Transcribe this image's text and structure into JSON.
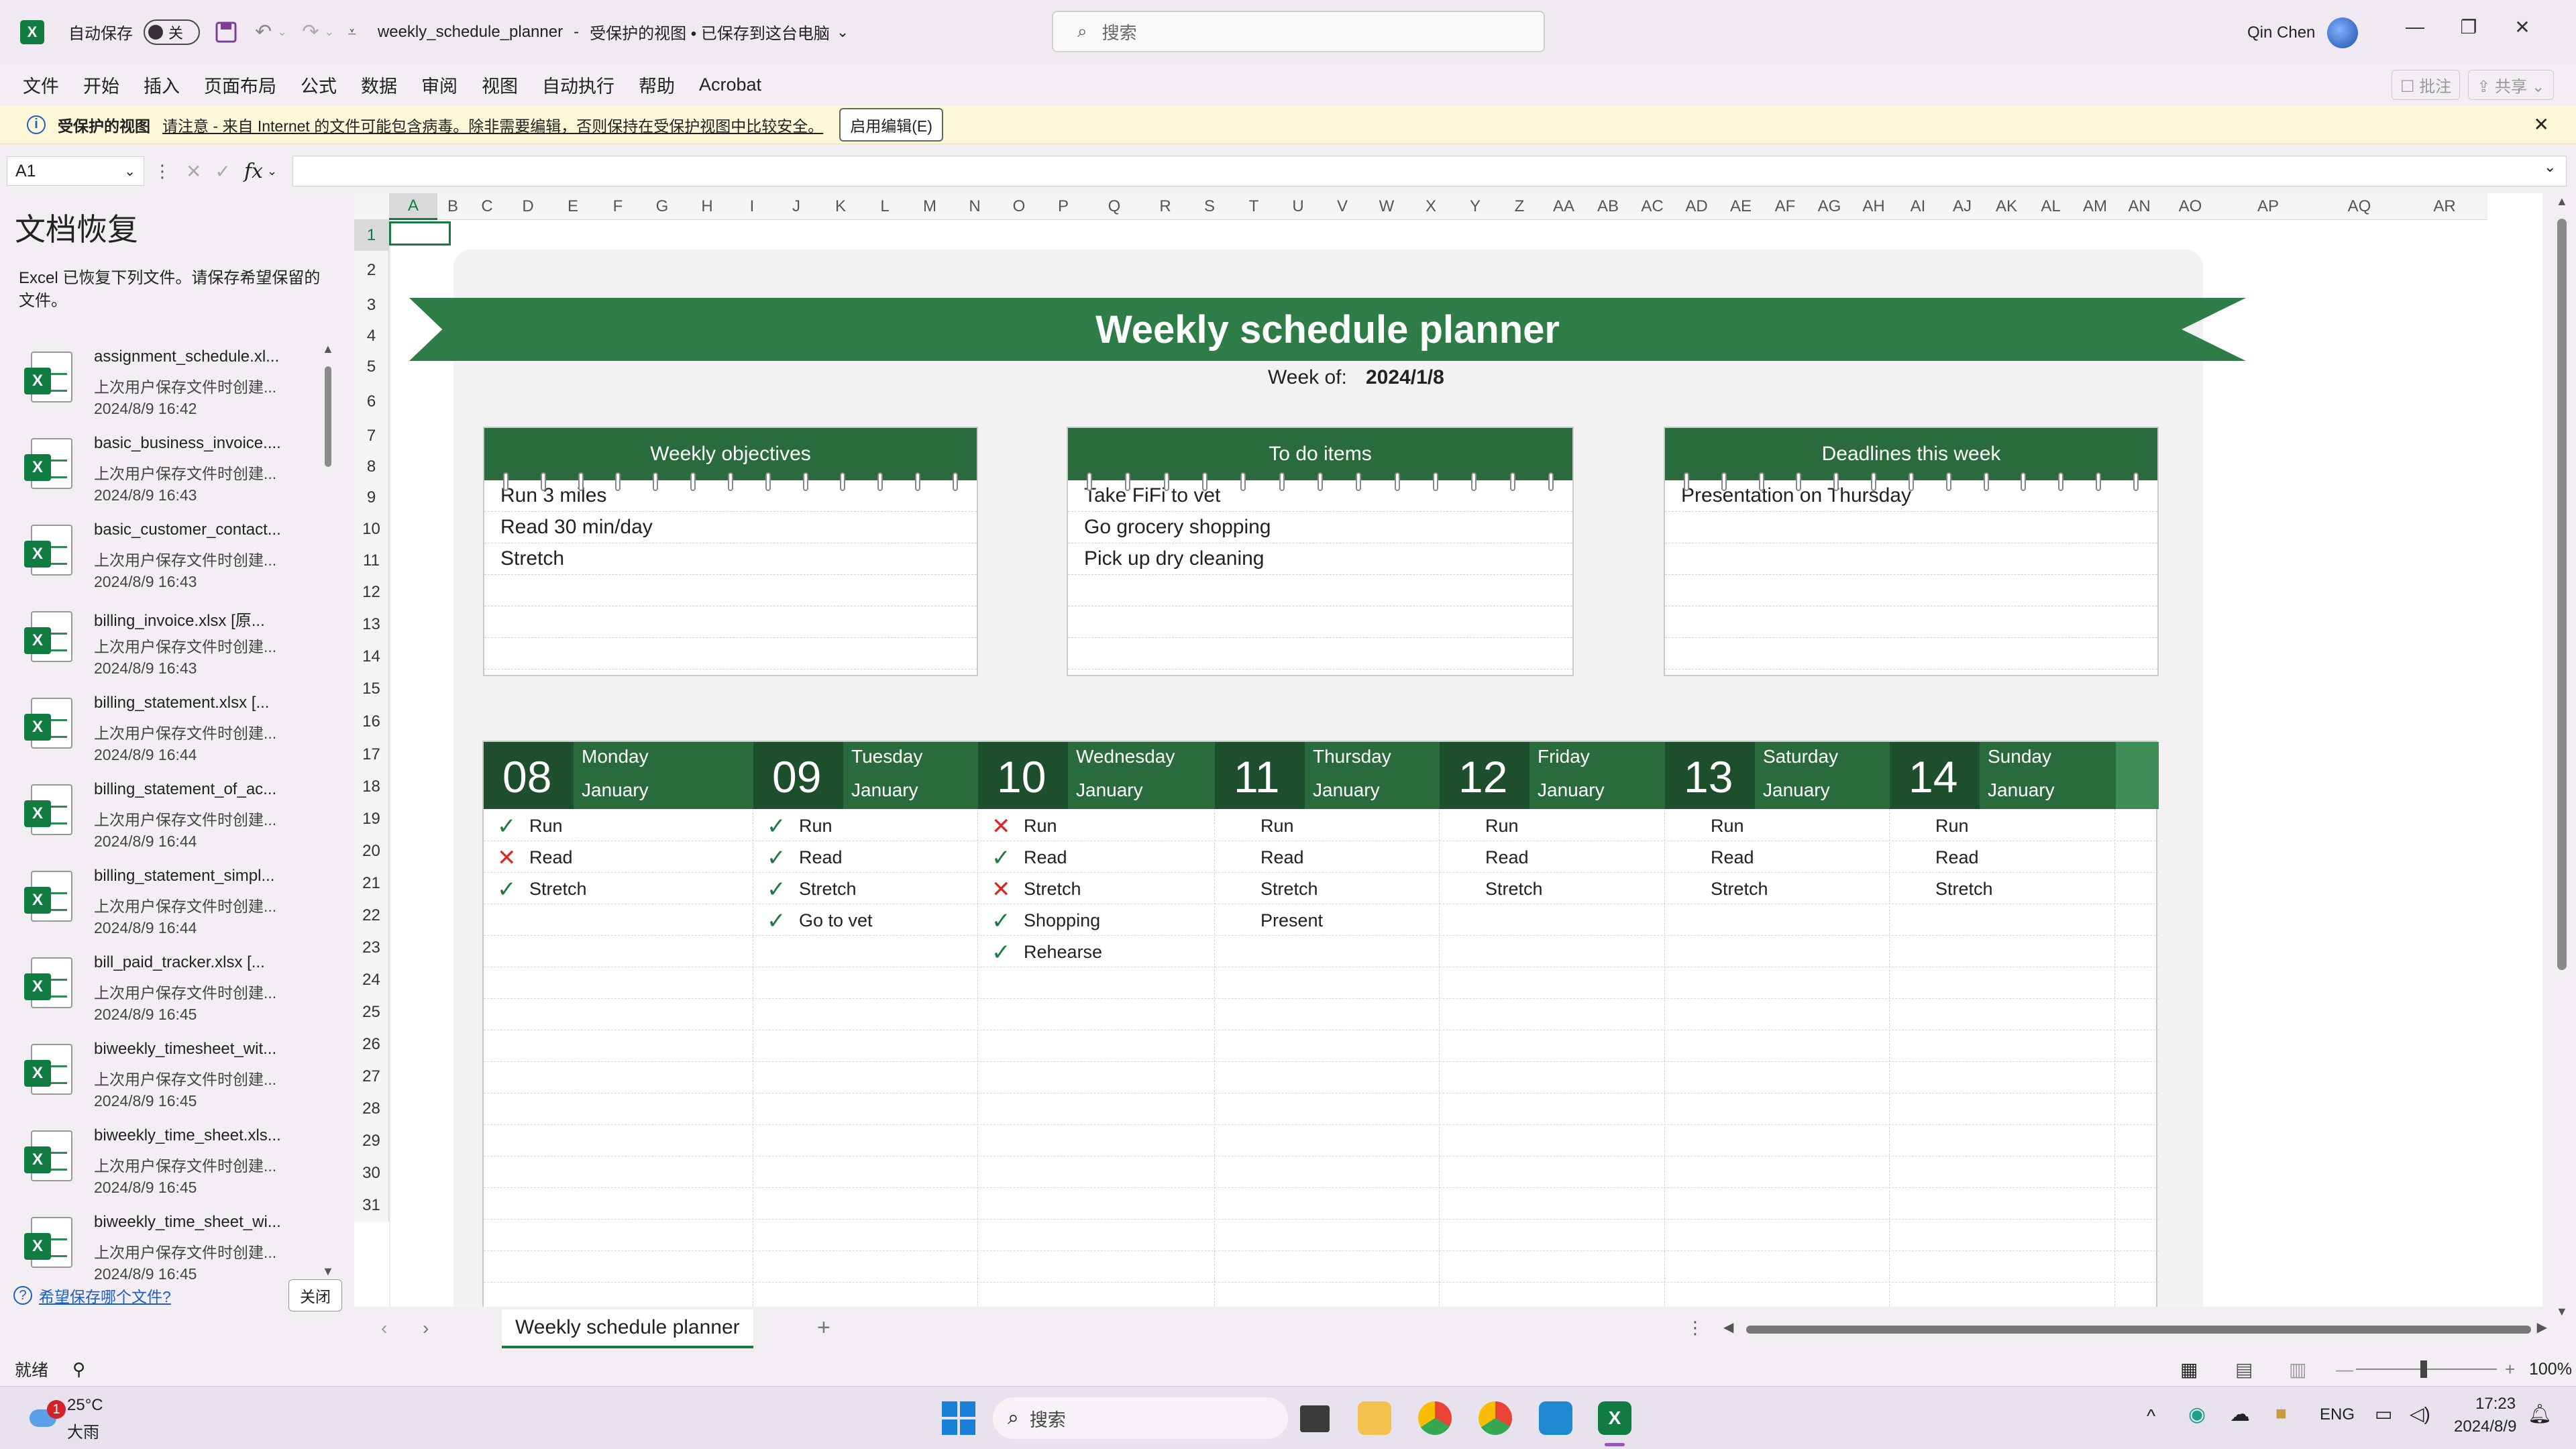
{
  "window": {
    "autosave_label": "自动保存",
    "autosave_state": "关",
    "doc_title": "weekly_schedule_planner",
    "doc_status": "受保护的视图 • 已保存到这台电脑",
    "search_placeholder": "搜索",
    "user_name": "Qin Chen"
  },
  "menu": {
    "items": [
      "文件",
      "开始",
      "插入",
      "页面布局",
      "公式",
      "数据",
      "审阅",
      "视图",
      "自动执行",
      "帮助",
      "Acrobat"
    ],
    "comment_label": "批注",
    "share_label": "共享"
  },
  "infobar": {
    "title": "受保护的视图",
    "message": "请注意 - 来自 Internet 的文件可能包含病毒。除非需要编辑，否则保持在受保护视图中比较安全。",
    "enable_button": "启用编辑(E)"
  },
  "formula": {
    "cell_ref": "A1",
    "fx": "fx"
  },
  "recovery": {
    "title": "文档恢复",
    "description": "Excel 已恢复下列文件。请保存希望保留的文件。",
    "files": [
      {
        "name": "assignment_schedule.xl...",
        "sub": "上次用户保存文件时创建...",
        "date": "2024/8/9 16:42"
      },
      {
        "name": "basic_business_invoice....",
        "sub": "上次用户保存文件时创建...",
        "date": "2024/8/9 16:43"
      },
      {
        "name": "basic_customer_contact...",
        "sub": "上次用户保存文件时创建...",
        "date": "2024/8/9 16:43"
      },
      {
        "name": "billing_invoice.xlsx  [原...",
        "sub": "上次用户保存文件时创建...",
        "date": "2024/8/9 16:43"
      },
      {
        "name": "billing_statement.xlsx  [...",
        "sub": "上次用户保存文件时创建...",
        "date": "2024/8/9 16:44"
      },
      {
        "name": "billing_statement_of_ac...",
        "sub": "上次用户保存文件时创建...",
        "date": "2024/8/9 16:44"
      },
      {
        "name": "billing_statement_simpl...",
        "sub": "上次用户保存文件时创建...",
        "date": "2024/8/9 16:44"
      },
      {
        "name": "bill_paid_tracker.xlsx  [...",
        "sub": "上次用户保存文件时创建...",
        "date": "2024/8/9 16:45"
      },
      {
        "name": "biweekly_timesheet_wit...",
        "sub": "上次用户保存文件时创建...",
        "date": "2024/8/9 16:45"
      },
      {
        "name": "biweekly_time_sheet.xls...",
        "sub": "上次用户保存文件时创建...",
        "date": "2024/8/9 16:45"
      },
      {
        "name": "biweekly_time_sheet_wi...",
        "sub": "上次用户保存文件时创建...",
        "date": "2024/8/9 16:45"
      }
    ],
    "link": "希望保存哪个文件?",
    "close_button": "关闭"
  },
  "columns": [
    "A",
    "B",
    "C",
    "D",
    "E",
    "F",
    "G",
    "H",
    "I",
    "J",
    "K",
    "L",
    "M",
    "N",
    "O",
    "P",
    "Q",
    "R",
    "S",
    "T",
    "U",
    "V",
    "W",
    "X",
    "Y",
    "Z",
    "AA",
    "AB",
    "AC",
    "AD",
    "AE",
    "AF",
    "AG",
    "AH",
    "AI",
    "AJ",
    "AK",
    "AL",
    "AM",
    "AN",
    "AO",
    "AP",
    "AQ",
    "AR"
  ],
  "rows": [
    "1",
    "2",
    "3",
    "4",
    "5",
    "6",
    "7",
    "8",
    "9",
    "10",
    "11",
    "12",
    "13",
    "14",
    "15",
    "16",
    "17",
    "18",
    "19",
    "20",
    "21",
    "22",
    "23",
    "24",
    "25",
    "26",
    "27",
    "28",
    "29",
    "30",
    "31"
  ],
  "planner": {
    "title": "Weekly schedule planner",
    "week_label": "Week of:",
    "week_value": "2024/1/8",
    "cards": [
      {
        "title": "Weekly objectives",
        "items": [
          "Run 3 miles",
          "Read 30 min/day",
          "Stretch",
          "",
          "",
          ""
        ]
      },
      {
        "title": "To do items",
        "items": [
          "Take FiFi to vet",
          "Go grocery shopping",
          "Pick up dry cleaning",
          "",
          "",
          ""
        ]
      },
      {
        "title": "Deadlines this week",
        "items": [
          "Presentation on Thursday",
          "",
          "",
          "",
          "",
          ""
        ]
      }
    ],
    "days": [
      {
        "num": "08",
        "name": "Monday",
        "month": "January",
        "tasks": [
          {
            "mark": "ok",
            "text": "Run"
          },
          {
            "mark": "no",
            "text": "Read"
          },
          {
            "mark": "ok",
            "text": "Stretch"
          }
        ]
      },
      {
        "num": "09",
        "name": "Tuesday",
        "month": "January",
        "tasks": [
          {
            "mark": "ok",
            "text": "Run"
          },
          {
            "mark": "ok",
            "text": "Read"
          },
          {
            "mark": "ok",
            "text": "Stretch"
          },
          {
            "mark": "ok",
            "text": "Go to vet"
          }
        ]
      },
      {
        "num": "10",
        "name": "Wednesday",
        "month": "January",
        "tasks": [
          {
            "mark": "no",
            "text": "Run"
          },
          {
            "mark": "ok",
            "text": "Read"
          },
          {
            "mark": "no",
            "text": "Stretch"
          },
          {
            "mark": "ok",
            "text": "Shopping"
          },
          {
            "mark": "ok",
            "text": "Rehearse"
          }
        ]
      },
      {
        "num": "11",
        "name": "Thursday",
        "month": "January",
        "tasks": [
          {
            "mark": "",
            "text": "Run"
          },
          {
            "mark": "",
            "text": "Read"
          },
          {
            "mark": "",
            "text": "Stretch"
          },
          {
            "mark": "",
            "text": "Present"
          }
        ]
      },
      {
        "num": "12",
        "name": "Friday",
        "month": "January",
        "tasks": [
          {
            "mark": "",
            "text": "Run"
          },
          {
            "mark": "",
            "text": "Read"
          },
          {
            "mark": "",
            "text": "Stretch"
          }
        ]
      },
      {
        "num": "13",
        "name": "Saturday",
        "month": "January",
        "tasks": [
          {
            "mark": "",
            "text": "Run"
          },
          {
            "mark": "",
            "text": "Read"
          },
          {
            "mark": "",
            "text": "Stretch"
          }
        ]
      },
      {
        "num": "14",
        "name": "Sunday",
        "month": "January",
        "tasks": [
          {
            "mark": "",
            "text": "Run"
          },
          {
            "mark": "",
            "text": "Read"
          },
          {
            "mark": "",
            "text": "Stretch"
          }
        ]
      }
    ]
  },
  "sheet_tab": "Weekly schedule planner",
  "status": {
    "ready": "就绪",
    "zoom": "100%"
  },
  "taskbar": {
    "weather_temp": "25°C",
    "weather_desc": "大雨",
    "weather_badge": "1",
    "search": "搜索",
    "lang": "ENG",
    "time": "17:23",
    "date": "2024/8/9"
  },
  "colors": {
    "accent": "#2e7d46",
    "header": "#2a6b3d",
    "check": "#1e7b3a",
    "cross": "#d42a2a"
  }
}
